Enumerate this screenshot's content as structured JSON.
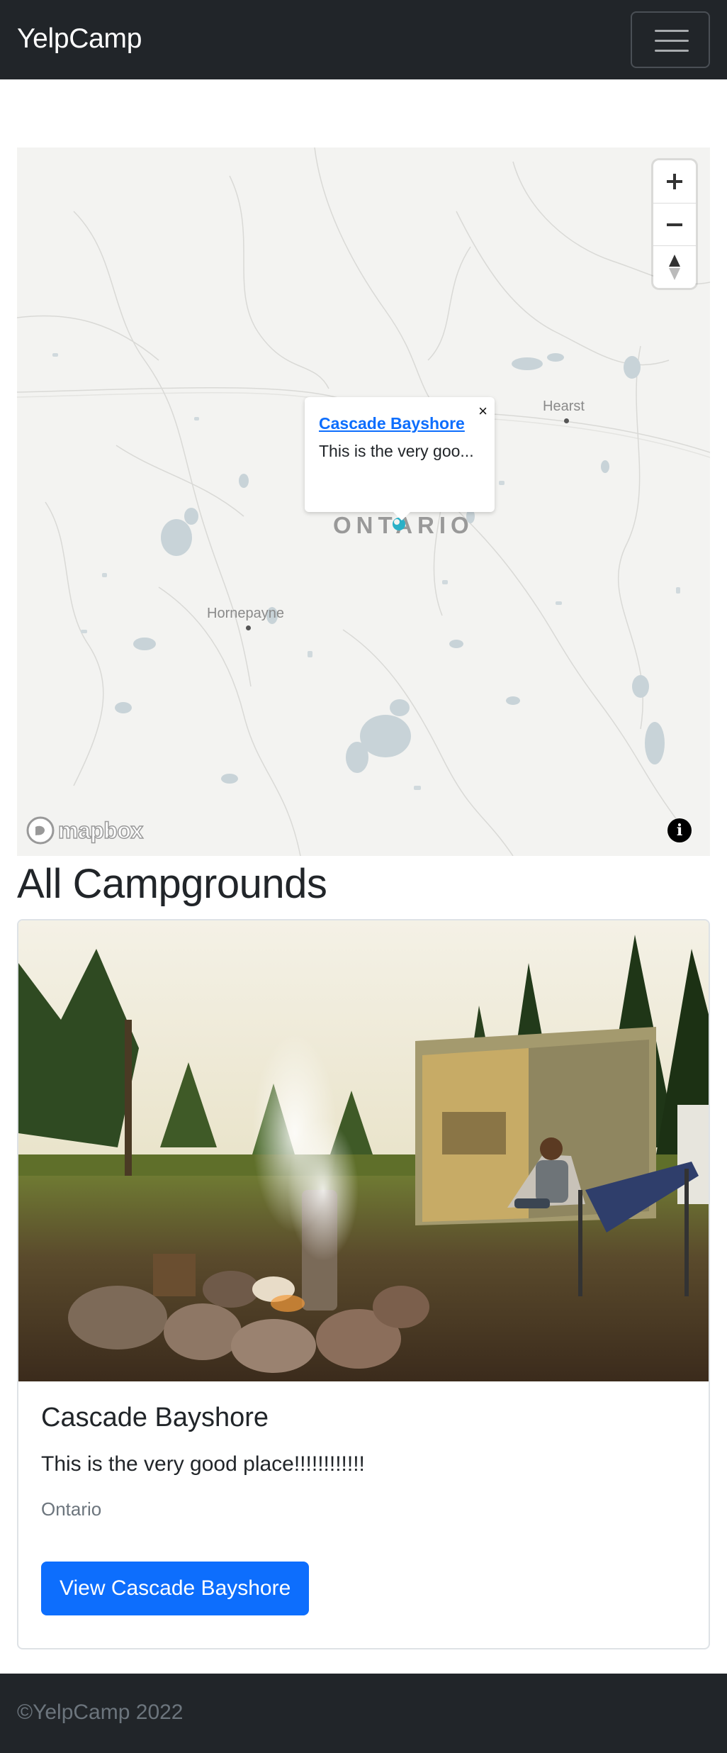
{
  "navbar": {
    "brand": "YelpCamp",
    "toggler_icon": "hamburger-icon"
  },
  "map": {
    "controls": {
      "zoom_in_icon": "plus-icon",
      "zoom_out_icon": "minus-icon",
      "compass_icon": "compass-icon"
    },
    "popup": {
      "title": "Cascade Bayshore",
      "description": "This is the very goo...",
      "close": "×"
    },
    "labels": {
      "region": "ONTARIO",
      "town_1": "Hearst",
      "town_2": "Hornepayne"
    },
    "attribution": {
      "logo": "mapbox",
      "info_icon": "info-icon",
      "info_glyph": "i"
    },
    "marker_color": "#2ab0c7"
  },
  "main": {
    "title": "All Campgrounds",
    "campgrounds": [
      {
        "title": "Cascade Bayshore",
        "description": "This is the very good place!!!!!!!!!!!!",
        "location": "Ontario",
        "button_label": "View Cascade Bayshore"
      }
    ]
  },
  "footer": {
    "text": "©YelpCamp 2022"
  },
  "colors": {
    "navbar_bg": "#212529",
    "primary": "#0d6efd",
    "muted": "#6c757d"
  }
}
